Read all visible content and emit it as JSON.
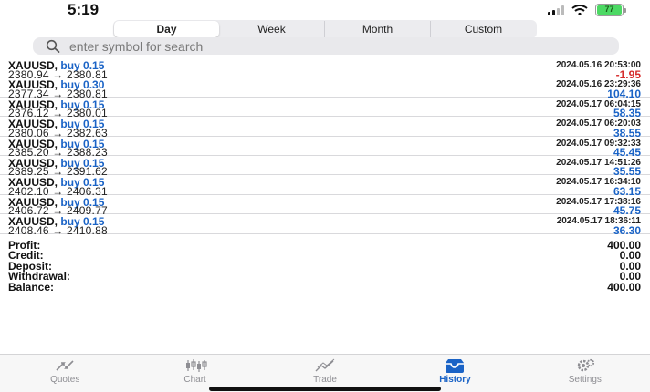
{
  "status_bar": {
    "time": "5:19",
    "battery": "77"
  },
  "tabs": [
    "Day",
    "Week",
    "Month",
    "Custom"
  ],
  "active_tab": 0,
  "search": {
    "placeholder": "enter symbol for search"
  },
  "trades": [
    {
      "symbol": "XAUUSD,",
      "action": "buy 0.15",
      "prices": "2380.94 → 2380.81",
      "datetime": "2024.05.16 20:53:00",
      "profit": "-1.95",
      "negative": true
    },
    {
      "symbol": "XAUUSD,",
      "action": "buy 0.30",
      "prices": "2377.34 → 2380.81",
      "datetime": "2024.05.16 23:29:36",
      "profit": "104.10",
      "negative": false
    },
    {
      "symbol": "XAUUSD,",
      "action": "buy 0.15",
      "prices": "2376.12 → 2380.01",
      "datetime": "2024.05.17 06:04:15",
      "profit": "58.35",
      "negative": false
    },
    {
      "symbol": "XAUUSD,",
      "action": "buy 0.15",
      "prices": "2380.06 → 2382.63",
      "datetime": "2024.05.17 06:20:03",
      "profit": "38.55",
      "negative": false
    },
    {
      "symbol": "XAUUSD,",
      "action": "buy 0.15",
      "prices": "2385.20 → 2388.23",
      "datetime": "2024.05.17 09:32:33",
      "profit": "45.45",
      "negative": false
    },
    {
      "symbol": "XAUUSD,",
      "action": "buy 0.15",
      "prices": "2389.25 → 2391.62",
      "datetime": "2024.05.17 14:51:26",
      "profit": "35.55",
      "negative": false
    },
    {
      "symbol": "XAUUSD,",
      "action": "buy 0.15",
      "prices": "2402.10 → 2406.31",
      "datetime": "2024.05.17 16:34:10",
      "profit": "63.15",
      "negative": false
    },
    {
      "symbol": "XAUUSD,",
      "action": "buy 0.15",
      "prices": "2406.72 → 2409.77",
      "datetime": "2024.05.17 17:38:16",
      "profit": "45.75",
      "negative": false
    },
    {
      "symbol": "XAUUSD,",
      "action": "buy 0.15",
      "prices": "2408.46 → 2410.88",
      "datetime": "2024.05.17 18:36:11",
      "profit": "36.30",
      "negative": false
    }
  ],
  "summary": [
    {
      "label": "Profit:",
      "value": "400.00"
    },
    {
      "label": "Credit:",
      "value": "0.00"
    },
    {
      "label": "Deposit:",
      "value": "0.00"
    },
    {
      "label": "Withdrawal:",
      "value": "0.00"
    },
    {
      "label": "Balance:",
      "value": "400.00"
    }
  ],
  "tabbar": [
    {
      "label": "Quotes",
      "icon": "quotes-icon"
    },
    {
      "label": "Chart",
      "icon": "chart-icon"
    },
    {
      "label": "Trade",
      "icon": "trade-icon"
    },
    {
      "label": "History",
      "icon": "history-icon"
    },
    {
      "label": "Settings",
      "icon": "settings-icon"
    }
  ],
  "active_tabbar": 3,
  "colors": {
    "accent": "#1a63c6",
    "loss": "#d52b2b"
  }
}
